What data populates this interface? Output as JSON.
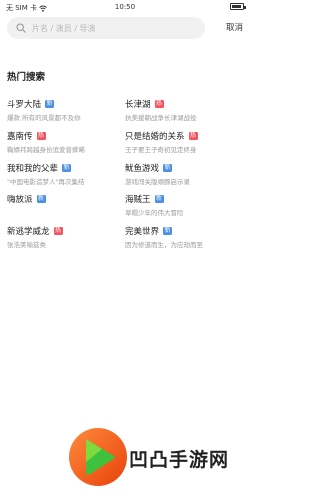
{
  "status_bar": {
    "carrier": "无 SIM 卡",
    "time": "10:50",
    "battery_level": 0.85
  },
  "search": {
    "placeholder": "片名 / 演员 / 导演",
    "value": "",
    "cancel_label": "取消"
  },
  "hot_search": {
    "title": "热门搜索",
    "items": [
      {
        "title": "斗罗大陆",
        "badge": "new",
        "badge_label": "新",
        "subtitle": "爆款 所有的风景都不及你"
      },
      {
        "title": "长津湖",
        "badge": "hot",
        "badge_label": "热",
        "subtitle": "抗美援朝战争长津湖战役"
      },
      {
        "title": "嘉南传",
        "badge": "hot",
        "badge_label": "热",
        "subtitle": "鞠婧祎跨越身份追爱曾舜晞"
      },
      {
        "title": "只是结婚的关系",
        "badge": "hot",
        "badge_label": "热",
        "subtitle": "王子要王子奇初见定终身"
      },
      {
        "title": "我和我的父辈",
        "badge": "new",
        "badge_label": "新",
        "subtitle": "\"中国电影造梦人\"再次集结"
      },
      {
        "title": "鱿鱼游戏",
        "badge": "new",
        "badge_label": "新",
        "subtitle": "游戏闯关版顺豚启示录"
      },
      {
        "title": "嗨放派",
        "badge": "new",
        "badge_label": "新",
        "subtitle": ""
      },
      {
        "title": "海贼王",
        "badge": "new",
        "badge_label": "新",
        "subtitle": "草帽少年的伟大冒险"
      },
      {
        "title": "新逃学威龙",
        "badge": "hot",
        "badge_label": "热",
        "subtitle": "张浩荚喻兹类"
      },
      {
        "title": "完美世界",
        "badge": "new",
        "badge_label": "新",
        "subtitle": "因为修道而生，为应劫而至"
      }
    ]
  },
  "watermark": {
    "text": "凹凸手游网"
  }
}
